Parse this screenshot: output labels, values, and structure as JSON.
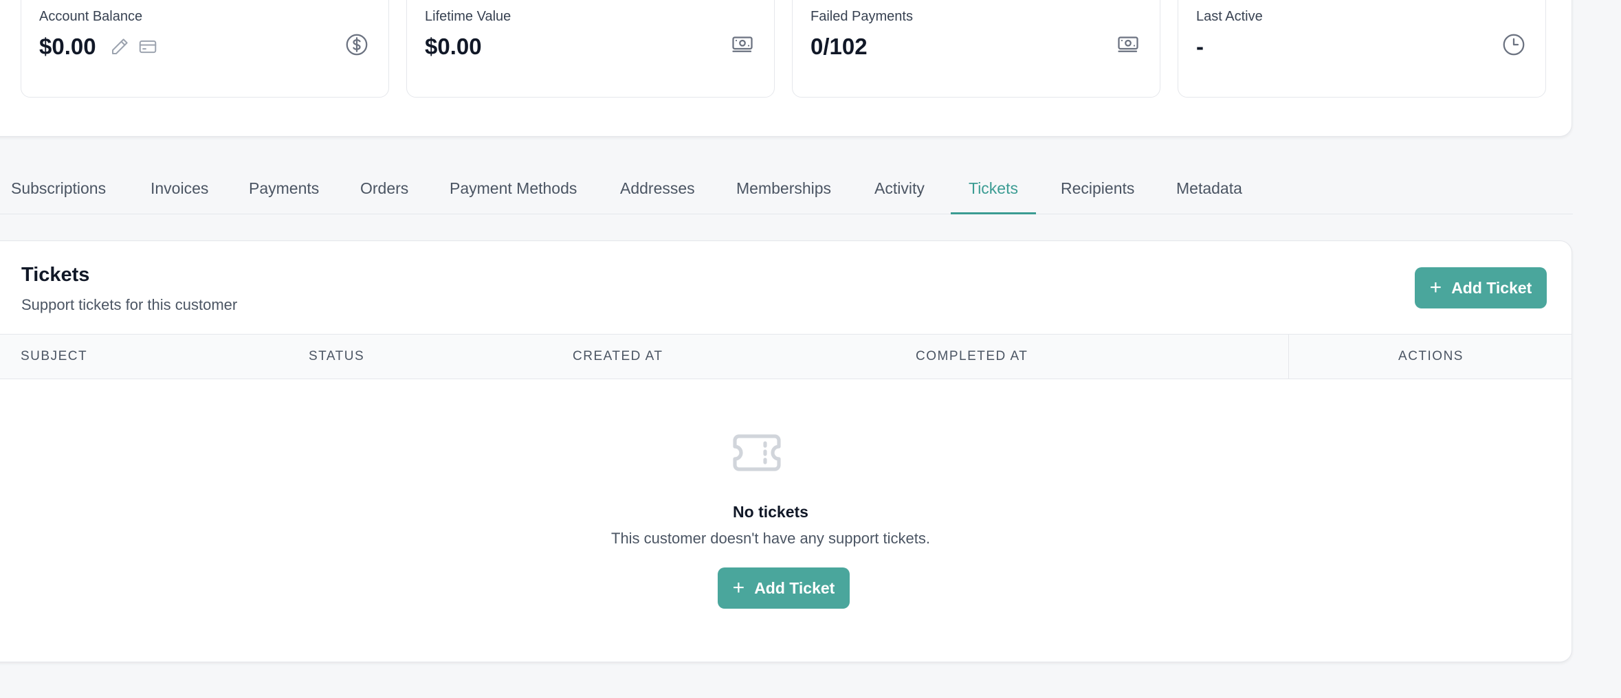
{
  "stats": [
    {
      "label": "Account Balance",
      "value": "$0.00",
      "icon": "dollar-circle-icon"
    },
    {
      "label": "Lifetime Value",
      "value": "$0.00",
      "icon": "banknote-icon"
    },
    {
      "label": "Failed Payments",
      "value": "0/102",
      "icon": "banknote-icon"
    },
    {
      "label": "Last Active",
      "value": "-",
      "icon": "clock-icon"
    }
  ],
  "tabs": [
    {
      "label": "Subscriptions"
    },
    {
      "label": "Invoices"
    },
    {
      "label": "Payments"
    },
    {
      "label": "Orders"
    },
    {
      "label": "Payment Methods"
    },
    {
      "label": "Addresses"
    },
    {
      "label": "Memberships"
    },
    {
      "label": "Activity"
    },
    {
      "label": "Tickets",
      "active": true
    },
    {
      "label": "Recipients"
    },
    {
      "label": "Metadata"
    }
  ],
  "tickets": {
    "title": "Tickets",
    "subtitle": "Support tickets for this customer",
    "add_button_label": "Add Ticket",
    "columns": [
      "SUBJECT",
      "STATUS",
      "CREATED AT",
      "COMPLETED AT",
      "ACTIONS"
    ],
    "empty_icon": "ticket-icon",
    "empty_title": "No tickets",
    "empty_description": "This customer doesn't have any support tickets.",
    "empty_button_label": "Add Ticket"
  },
  "colors": {
    "accent": "#4aa69c",
    "accent_text": "#3b9c93",
    "background": "#f6f7f9",
    "border": "#e5e7eb"
  }
}
